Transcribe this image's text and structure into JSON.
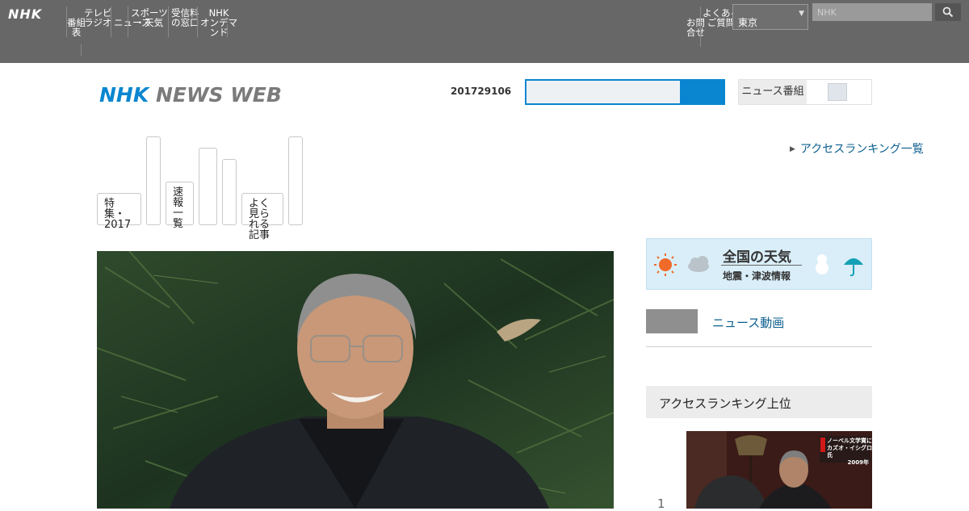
{
  "global_nav": {
    "logo": "NHK",
    "items": [
      [
        "番組",
        "表"
      ],
      [
        "テレビ",
        "ラジオ",
        "の番組"
      ],
      [
        "ニュース"
      ],
      [
        "スポーツ",
        "・天気"
      ],
      [
        "受信料",
        "の窓口"
      ],
      [
        "NHK",
        "オンデマ",
        "ンド"
      ]
    ],
    "right_item": [
      "お問",
      "合せ"
    ],
    "right_item2": [
      "よくある",
      "ご質問"
    ],
    "region_select": "東京",
    "search_placeholder": "NHK"
  },
  "header": {
    "logo_nhk": "NHK",
    "logo_newsweb": "NEWS WEB",
    "date": "201729106",
    "search_value": "",
    "toggle_label": "ニュース番組"
  },
  "categories": [
    [
      "特集・",
      "2017"
    ],
    [
      ""
    ],
    [
      "速報",
      "一覧"
    ],
    [
      ""
    ],
    [
      ""
    ],
    [
      "よく見られる",
      "記事"
    ],
    [
      ""
    ]
  ],
  "ranking_link": "アクセスランキング一覧",
  "sidebar": {
    "weather_title": "全国の天気",
    "weather_sub": "地震・津波情報",
    "side_link": "ニュース動画",
    "ranking_heading": "アクセスランキング上位",
    "rank_number": "1",
    "thumb_caption_1": "ノーベル文学賞に",
    "thumb_caption_2": "カズオ・イシグロ氏",
    "thumb_caption_3": "2009年"
  },
  "colors": {
    "accent_blue": "#0a86d0",
    "link_blue": "#0b5f8e",
    "global_bar": "#676767"
  }
}
